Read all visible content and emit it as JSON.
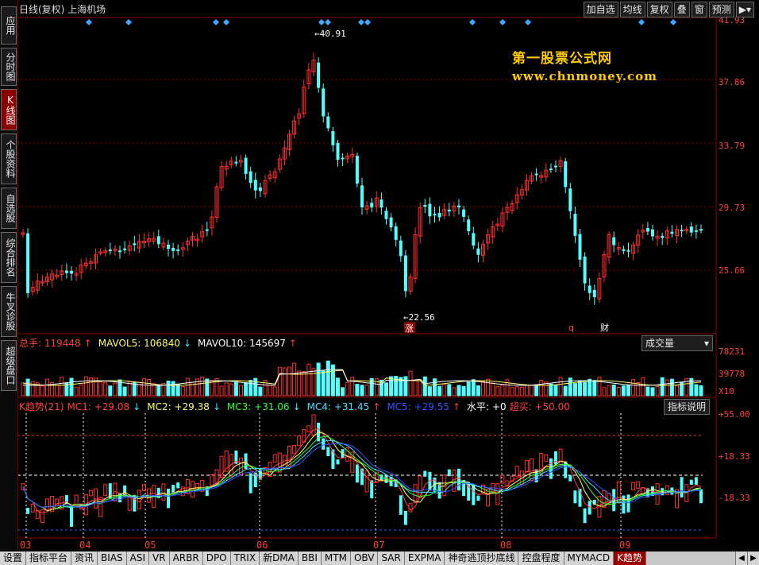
{
  "left_nav": [
    {
      "label": "应用",
      "active": false
    },
    {
      "label": "分时图",
      "active": false
    },
    {
      "label": "K线图",
      "active": true
    },
    {
      "label": "个股资料",
      "active": false
    },
    {
      "label": "自选股",
      "active": false
    },
    {
      "label": "综合排名",
      "active": false
    },
    {
      "label": "牛叉诊股",
      "active": false
    },
    {
      "label": "超级盘口",
      "active": false
    }
  ],
  "header": {
    "title": "日线(复权)  上海机场",
    "buttons": [
      "加自选",
      "均线",
      "复权",
      "叠",
      "窗",
      "预测"
    ],
    "expand_icon": "play-menu-icon"
  },
  "watermark": {
    "line1": "第一股票公式网",
    "line2": "www.chnmoney.com"
  },
  "price_panel": {
    "scale": [
      "41.93",
      "37.86",
      "33.79",
      "29.73",
      "25.66"
    ],
    "high_marker": "40.91",
    "low_marker": "22.56",
    "markers": [
      "涨",
      "q",
      "财"
    ]
  },
  "volume_panel": {
    "header": [
      {
        "text": "总手: 119448",
        "color": "#ff4040"
      },
      {
        "text": "↑",
        "color": "#ff4040"
      },
      {
        "text": "MAVOL5: 106840",
        "color": "#ffff66"
      },
      {
        "text": "↓",
        "color": "#40e0ff"
      },
      {
        "text": "MAVOL10: 145697",
        "color": "#ffffff"
      },
      {
        "text": "↑",
        "color": "#ff4040"
      }
    ],
    "dropdown": "成交量",
    "scale": [
      "78231",
      "39778"
    ],
    "unit": "X10"
  },
  "indicator_panel": {
    "header": [
      {
        "text": "K趋势(21)",
        "color": "#ff4040"
      },
      {
        "text": "MC1: +29.08",
        "color": "#ff4040"
      },
      {
        "text": "↓",
        "color": "#40e0ff"
      },
      {
        "text": "MC2: +29.38",
        "color": "#ffff66"
      },
      {
        "text": "↓",
        "color": "#40e0ff"
      },
      {
        "text": "MC3: +31.06",
        "color": "#33ff33"
      },
      {
        "text": "↓",
        "color": "#40e0ff"
      },
      {
        "text": "MC4: +31.45",
        "color": "#40e0ff"
      },
      {
        "text": "↑",
        "color": "#ff4040"
      },
      {
        "text": "MC5: +29.55",
        "color": "#3355ff"
      },
      {
        "text": "↑",
        "color": "#ff4040"
      },
      {
        "text": "水平: +0",
        "color": "#ffffff"
      },
      {
        "text": "超买: +50.00",
        "color": "#ff4040"
      }
    ],
    "button": "指标说明",
    "scale": [
      "+55.00",
      "+18.33",
      "-18.33"
    ]
  },
  "date_axis": [
    "03",
    "04",
    "05",
    "06",
    "07",
    "08",
    "09"
  ],
  "tabs": [
    {
      "label": "设置",
      "active": false
    },
    {
      "label": "指标平台",
      "active": false
    },
    {
      "label": "资讯",
      "active": false
    },
    {
      "label": "BIAS",
      "active": false
    },
    {
      "label": "ASI",
      "active": false
    },
    {
      "label": "VR",
      "active": false
    },
    {
      "label": "ARBR",
      "active": false
    },
    {
      "label": "DPO",
      "active": false
    },
    {
      "label": "TRIX",
      "active": false
    },
    {
      "label": "新DMA",
      "active": false
    },
    {
      "label": "BBI",
      "active": false
    },
    {
      "label": "MTM",
      "active": false
    },
    {
      "label": "OBV",
      "active": false
    },
    {
      "label": "SAR",
      "active": false
    },
    {
      "label": "EXPMA",
      "active": false
    },
    {
      "label": "神奇逃顶抄底线",
      "active": false
    },
    {
      "label": "控盘程度",
      "active": false
    },
    {
      "label": "MYMACD",
      "active": false
    },
    {
      "label": "K趋势",
      "active": true
    }
  ],
  "colors": {
    "up": "#ff3030",
    "down": "#54ffff",
    "grid": "#8b0000",
    "axis_text": "#ff4040"
  }
}
